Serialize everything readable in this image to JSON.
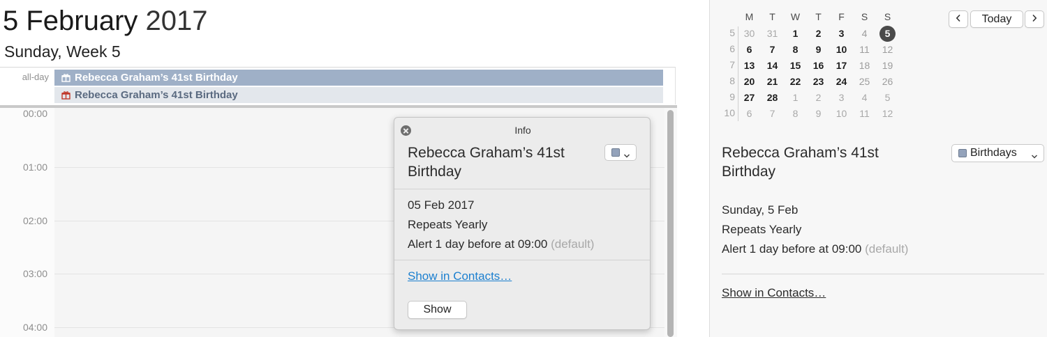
{
  "header": {
    "day_month": "5 February",
    "year": "2017",
    "subtitle": "Sunday, Week 5"
  },
  "all_day": {
    "label": "all-day",
    "events": [
      {
        "title": "Rebecca Graham’s 41st Birthday",
        "icon": "gift-icon",
        "color": "#9fb0c7"
      },
      {
        "title": "Rebecca Graham’s 41st Birthday",
        "icon": "gift-icon",
        "color": "#e3e7ec"
      }
    ]
  },
  "time_grid": {
    "hours": [
      "00:00",
      "01:00",
      "02:00",
      "03:00",
      "04:00"
    ]
  },
  "popover": {
    "title": "Info",
    "event_name": "Rebecca Graham’s 41st Birthday",
    "calendar_color": "#94a3bb",
    "date": "05 Feb 2017",
    "repeat": "Repeats Yearly",
    "alert": "Alert 1 day before at 09:00",
    "alert_default": "(default)",
    "contacts_link": "Show in Contacts…",
    "show_button": "Show"
  },
  "mini_calendar": {
    "weekday_headers": [
      "M",
      "T",
      "W",
      "T",
      "F",
      "S",
      "S"
    ],
    "weeks": [
      {
        "number": "5",
        "days": [
          "30",
          "31",
          "1",
          "2",
          "3",
          "4",
          "5"
        ]
      },
      {
        "number": "6",
        "days": [
          "6",
          "7",
          "8",
          "9",
          "10",
          "11",
          "12"
        ]
      },
      {
        "number": "7",
        "days": [
          "13",
          "14",
          "15",
          "16",
          "17",
          "18",
          "19"
        ]
      },
      {
        "number": "8",
        "days": [
          "20",
          "21",
          "22",
          "23",
          "24",
          "25",
          "26"
        ]
      },
      {
        "number": "9",
        "days": [
          "27",
          "28",
          "1",
          "2",
          "3",
          "4",
          "5"
        ]
      },
      {
        "number": "10",
        "days": [
          "6",
          "7",
          "8",
          "9",
          "10",
          "11",
          "12"
        ]
      }
    ],
    "selected_day": "5"
  },
  "navigation": {
    "today_label": "Today",
    "prev_icon": "chevron-left-icon",
    "next_icon": "chevron-right-icon"
  },
  "detail_panel": {
    "event_name": "Rebecca Graham’s 41st Birthday",
    "calendar_name": "Birthdays",
    "calendar_color": "#94a3bb",
    "date": "Sunday, 5 Feb",
    "repeat": "Repeats Yearly",
    "alert": "Alert 1 day before at 09:00",
    "alert_default": "(default)",
    "contacts_link": "Show in Contacts…"
  },
  "colors": {
    "accent_link": "#1b7fcf",
    "today_circle": "#4a4a4a"
  }
}
